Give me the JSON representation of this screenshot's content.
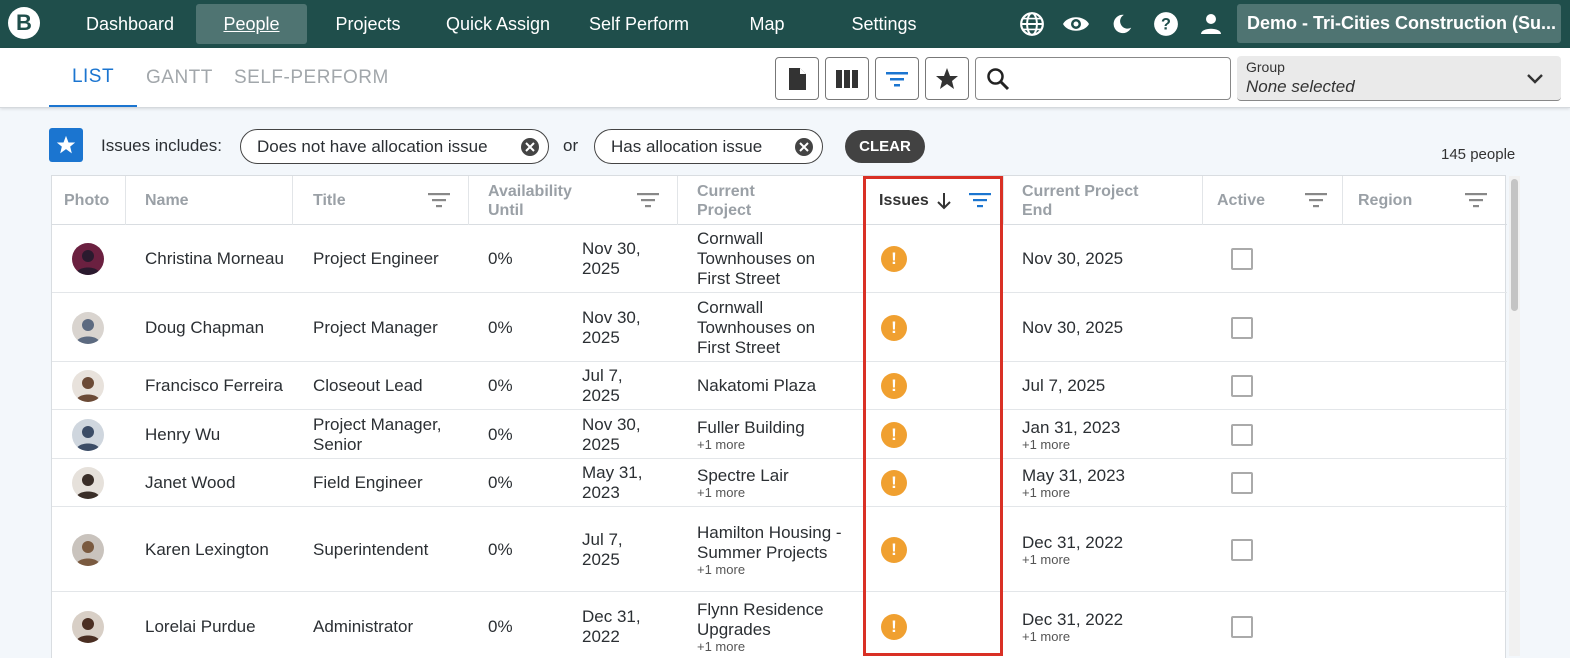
{
  "nav": {
    "logo": "B",
    "items": [
      {
        "label": "Dashboard"
      },
      {
        "label": "People"
      },
      {
        "label": "Projects"
      },
      {
        "label": "Quick Assign"
      },
      {
        "label": "Self Perform"
      },
      {
        "label": "Map"
      },
      {
        "label": "Settings"
      }
    ],
    "icons": [
      "globe-icon",
      "eye-icon",
      "moon-icon",
      "help-icon",
      "account-icon"
    ],
    "company": "Demo - Tri-Cities Construction (Su..."
  },
  "tabs": [
    {
      "label": "LIST"
    },
    {
      "label": "GANTT"
    },
    {
      "label": "SELF-PERFORM"
    }
  ],
  "toolbar": {
    "tools": [
      "document-icon",
      "columns-icon",
      "filter-icon",
      "star-icon"
    ],
    "search_value": "",
    "group_label": "Group",
    "group_value": "None selected"
  },
  "filters": {
    "label": "Issues includes:",
    "chips": [
      {
        "label": "Does not have allocation issue"
      },
      {
        "label": "Has allocation issue"
      }
    ],
    "or": "or",
    "clear": "CLEAR",
    "count": "145 people"
  },
  "colors": {
    "nav_bg": "#1f4e4b",
    "accent": "#1b75d0",
    "warning": "#f0a030",
    "highlight": "#d93025"
  },
  "table": {
    "headers": {
      "photo": "Photo",
      "name": "Name",
      "title": "Title",
      "availability": "Availability Until",
      "project": "Current Project",
      "issues": "Issues",
      "project_end": "Current Project End",
      "active": "Active",
      "region": "Region"
    },
    "rows": [
      {
        "name": "Christina Morneau",
        "title": "Project Engineer",
        "pct": "0%",
        "until": "Nov 30, 2025",
        "project": "Cornwall Townhouses on First Street",
        "project_more": "",
        "end": "Nov 30, 2025",
        "end_more": "",
        "issue": "!"
      },
      {
        "name": "Doug Chapman",
        "title": "Project Manager",
        "pct": "0%",
        "until": "Nov 30, 2025",
        "project": "Cornwall Townhouses on First Street",
        "project_more": "",
        "end": "Nov 30, 2025",
        "end_more": "",
        "issue": "!"
      },
      {
        "name": "Francisco Ferreira",
        "title": "Closeout Lead",
        "pct": "0%",
        "until": "Jul 7, 2025",
        "project": "Nakatomi Plaza",
        "project_more": "",
        "end": "Jul 7, 2025",
        "end_more": "",
        "issue": "!"
      },
      {
        "name": "Henry Wu",
        "title": "Project Manager, Senior",
        "pct": "0%",
        "until": "Nov 30, 2025",
        "project": "Fuller Building",
        "project_more": "+1 more",
        "end": "Jan 31, 2023",
        "end_more": "+1 more",
        "issue": "!"
      },
      {
        "name": "Janet Wood",
        "title": "Field Engineer",
        "pct": "0%",
        "until": "May 31, 2023",
        "project": "Spectre Lair",
        "project_more": "+1 more",
        "end": "May 31, 2023",
        "end_more": "+1 more",
        "issue": "!"
      },
      {
        "name": "Karen Lexington",
        "title": "Superintendent",
        "pct": "0%",
        "until": "Jul 7, 2025",
        "project": "Hamilton Housing - Summer Projects",
        "project_more": "+1 more",
        "end": "Dec 31, 2022",
        "end_more": "+1 more",
        "issue": "!"
      },
      {
        "name": "Lorelai Purdue",
        "title": "Administrator",
        "pct": "0%",
        "until": "Dec 31, 2022",
        "project": "Flynn Residence Upgrades",
        "project_more": "+1 more",
        "end": "Dec 31, 2022",
        "end_more": "+1 more",
        "issue": "!"
      }
    ]
  }
}
